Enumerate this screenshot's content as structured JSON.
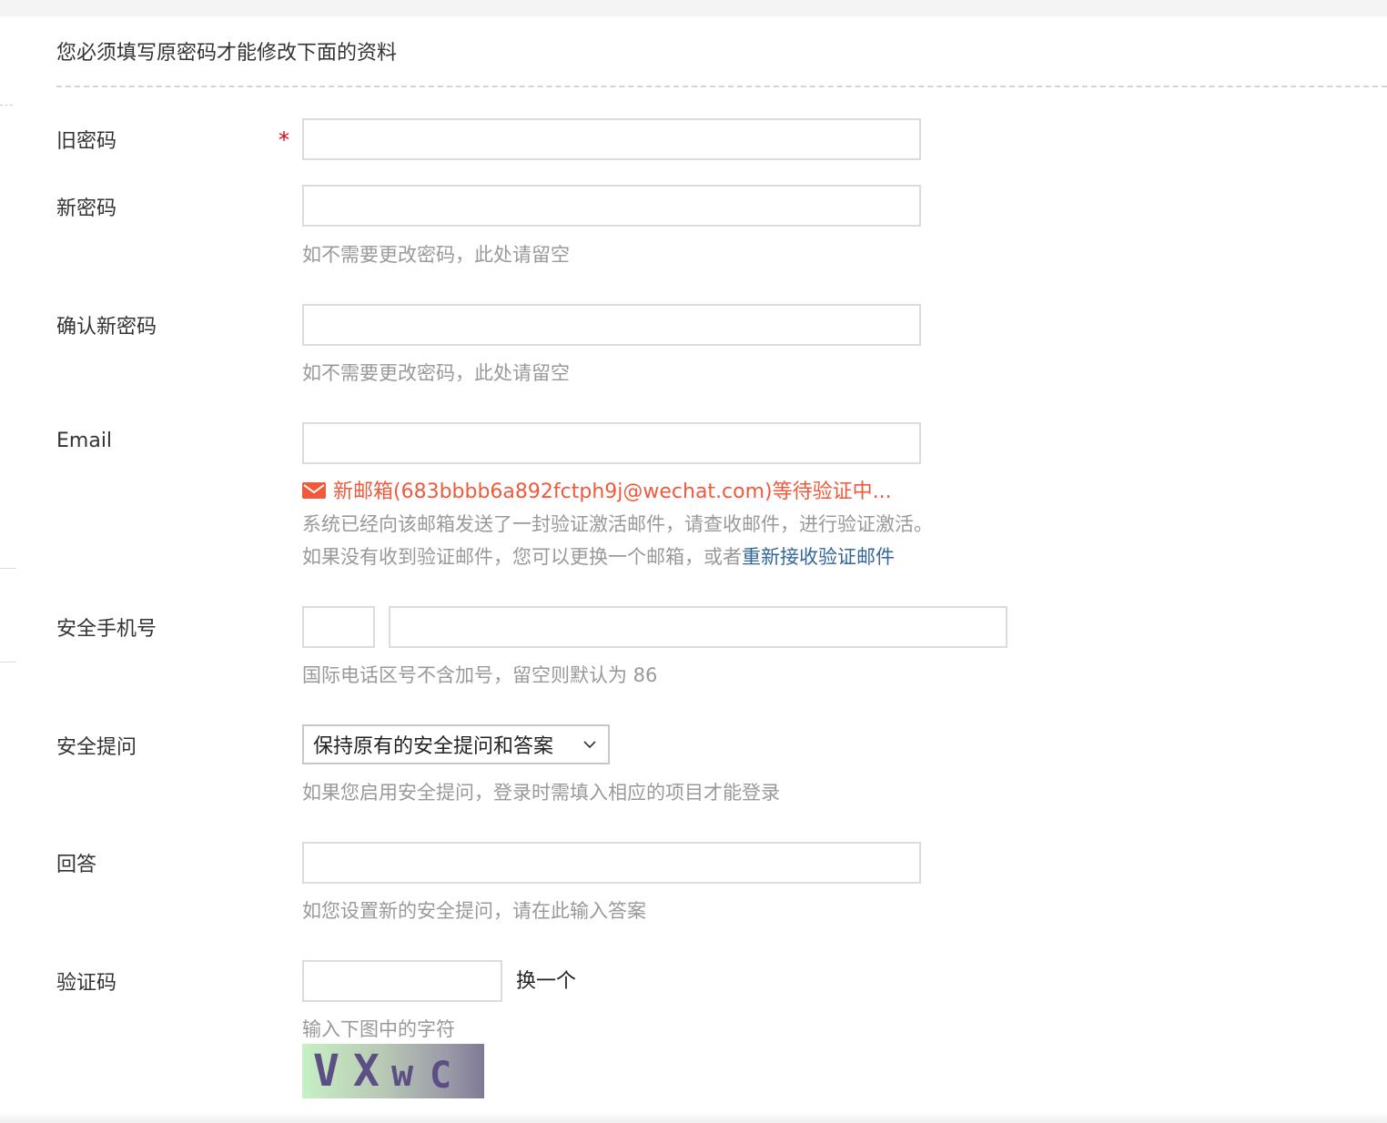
{
  "notice": "您必须填写原密码才能修改下面的资料",
  "fields": {
    "old_password": {
      "label": "旧密码",
      "required_mark": "*",
      "value": ""
    },
    "new_password": {
      "label": "新密码",
      "value": "",
      "hint": "如不需要更改密码，此处请留空"
    },
    "confirm_password": {
      "label": "确认新密码",
      "value": "",
      "hint": "如不需要更改密码，此处请留空"
    },
    "email": {
      "label": "Email",
      "value": "",
      "pending_notice": "新邮箱(683bbbb6a892fctph9j@wechat.com)等待验证中...",
      "sent_text": "系统已经向该邮箱发送了一封验证激活邮件，请查收邮件，进行验证激活。",
      "resend_prefix": "如果没有收到验证邮件，您可以更换一个邮箱，或者",
      "resend_link": "重新接收验证邮件"
    },
    "phone": {
      "label": "安全手机号",
      "country_code": "",
      "number": "",
      "hint": "国际电话区号不含加号，留空则默认为 86"
    },
    "security_question": {
      "label": "安全提问",
      "selected": "保持原有的安全提问和答案",
      "hint": "如果您启用安全提问，登录时需填入相应的项目才能登录"
    },
    "answer": {
      "label": "回答",
      "value": "",
      "hint": "如您设置新的安全提问，请在此输入答案"
    },
    "captcha": {
      "label": "验证码",
      "value": "",
      "swap_label": "换一个",
      "hint": "输入下图中的字符",
      "image_text": "VXwC"
    }
  },
  "colors": {
    "required": "#e60012",
    "warning": "#f05a3c",
    "link": "#336699",
    "hint": "#999999"
  },
  "icons": {
    "email_status": "mail-icon",
    "select_arrow": "chevron-down-icon"
  }
}
